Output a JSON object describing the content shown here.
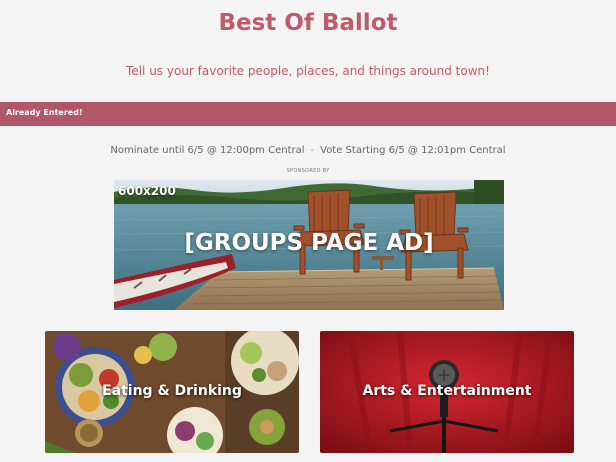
{
  "header": {
    "title": "Best Of Ballot",
    "subtitle": "Tell us your favorite people, places, and things around town!"
  },
  "status_banner": {
    "text": "Already Entered!"
  },
  "schedule": {
    "nominate": "Nominate until 6/5 @ 12:00pm Central",
    "separator": "-",
    "vote": "Vote Starting 6/5 @ 12:01pm Central"
  },
  "sponsored_label": "SPONSORED BY",
  "ad": {
    "size_label": "600x200",
    "placeholder": "[GROUPS PAGE AD]"
  },
  "categories": [
    {
      "label": "Eating & Drinking",
      "accent": "#7a4e2f"
    },
    {
      "label": "Arts & Entertainment",
      "accent": "#b71c24"
    }
  ],
  "colors": {
    "brand": "#bf5a68",
    "banner": "#b25766",
    "background": "#f4f4f4"
  }
}
